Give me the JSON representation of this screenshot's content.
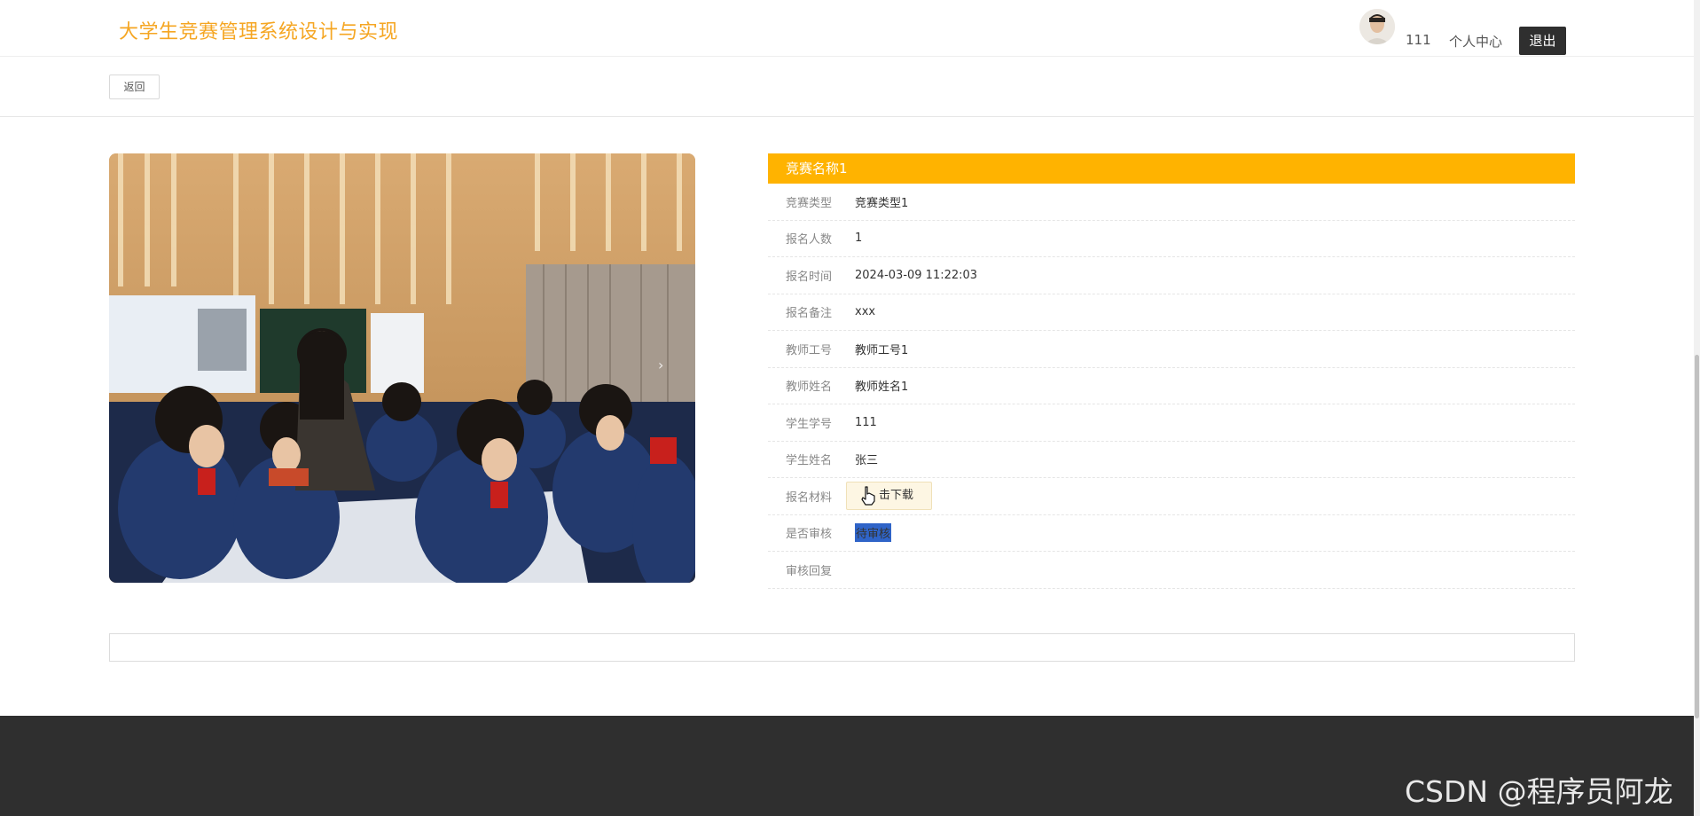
{
  "header": {
    "site_title": "大学生竞赛管理系统设计与实现",
    "user_name": "111",
    "user_center": "个人中心",
    "logout": "退出"
  },
  "toolbar": {
    "back": "返回"
  },
  "detail": {
    "title": "竞赛名称1",
    "fields": [
      {
        "label": "竞赛类型",
        "value": "竞赛类型1"
      },
      {
        "label": "报名人数",
        "value": "1"
      },
      {
        "label": "报名时间",
        "value": "2024-03-09 11:22:03"
      },
      {
        "label": "报名备注",
        "value": "xxx"
      },
      {
        "label": "教师工号",
        "value": "教师工号1"
      },
      {
        "label": "教师姓名",
        "value": "教师姓名1"
      },
      {
        "label": "学生学号",
        "value": "111"
      },
      {
        "label": "学生姓名",
        "value": "张三"
      },
      {
        "label": "报名材料",
        "value": "击下载"
      },
      {
        "label": "是否审核",
        "value": "待审核"
      },
      {
        "label": "审核回复",
        "value": ""
      }
    ]
  },
  "watermark": "CSDN @程序员阿龙",
  "colors": {
    "accent": "#ffb300",
    "title": "#f5a623",
    "footer": "#2f2f2f",
    "selection": "#2f64c8"
  },
  "icons": {
    "carousel_next": "chevron-right-icon",
    "cursor": "hand-pointer-icon"
  }
}
